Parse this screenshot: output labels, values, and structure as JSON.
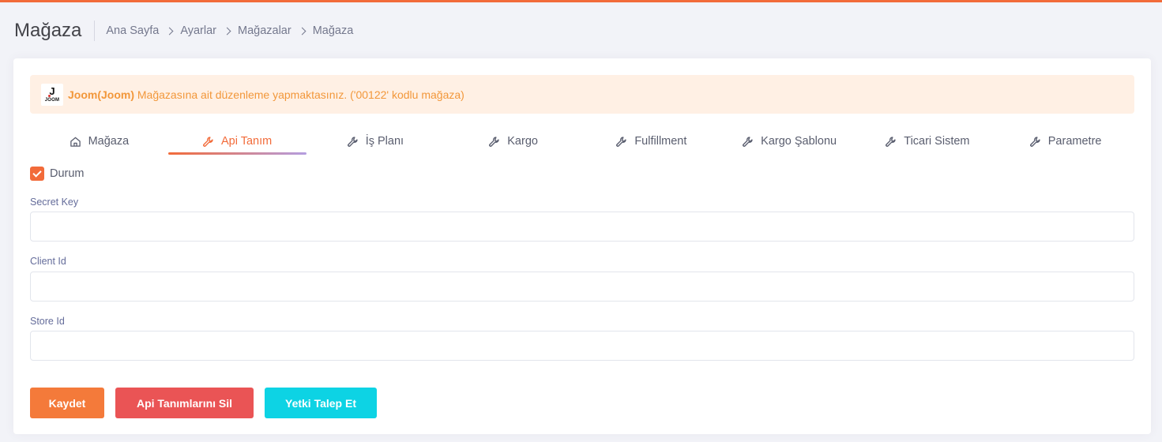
{
  "header": {
    "title": "Mağaza",
    "breadcrumb": [
      "Ana Sayfa",
      "Ayarlar",
      "Mağazalar",
      "Mağaza"
    ]
  },
  "alert": {
    "logo_letter": "J",
    "logo_text": "JOOM",
    "store_name": "Joom(Joom)",
    "message": " Mağazasına ait düzenleme yapmaktasınız. ('00122' kodlu mağaza)"
  },
  "tabs": [
    {
      "label": "Mağaza",
      "icon": "home-icon",
      "active": false
    },
    {
      "label": "Api Tanım",
      "icon": "wrench-icon",
      "active": true
    },
    {
      "label": "İş Planı",
      "icon": "wrench-icon",
      "active": false
    },
    {
      "label": "Kargo",
      "icon": "wrench-icon",
      "active": false
    },
    {
      "label": "Fulfillment",
      "icon": "wrench-icon",
      "active": false
    },
    {
      "label": "Kargo Şablonu",
      "icon": "wrench-icon",
      "active": false
    },
    {
      "label": "Ticari Sistem",
      "icon": "wrench-icon",
      "active": false
    },
    {
      "label": "Parametre",
      "icon": "wrench-icon",
      "active": false
    }
  ],
  "form": {
    "status": {
      "label": "Durum",
      "checked": true
    },
    "secret_key": {
      "label": "Secret Key",
      "value": ""
    },
    "client_id": {
      "label": "Client Id",
      "value": ""
    },
    "store_id": {
      "label": "Store Id",
      "value": ""
    }
  },
  "actions": {
    "save": "Kaydet",
    "delete": "Api Tanımlarını Sil",
    "auth": "Yetki Talep Et"
  },
  "colors": {
    "accent": "#f26b3a",
    "alert_bg": "#fff0e4",
    "alert_text": "#f2973a",
    "danger": "#ea5455",
    "info": "#0dd3e4"
  }
}
